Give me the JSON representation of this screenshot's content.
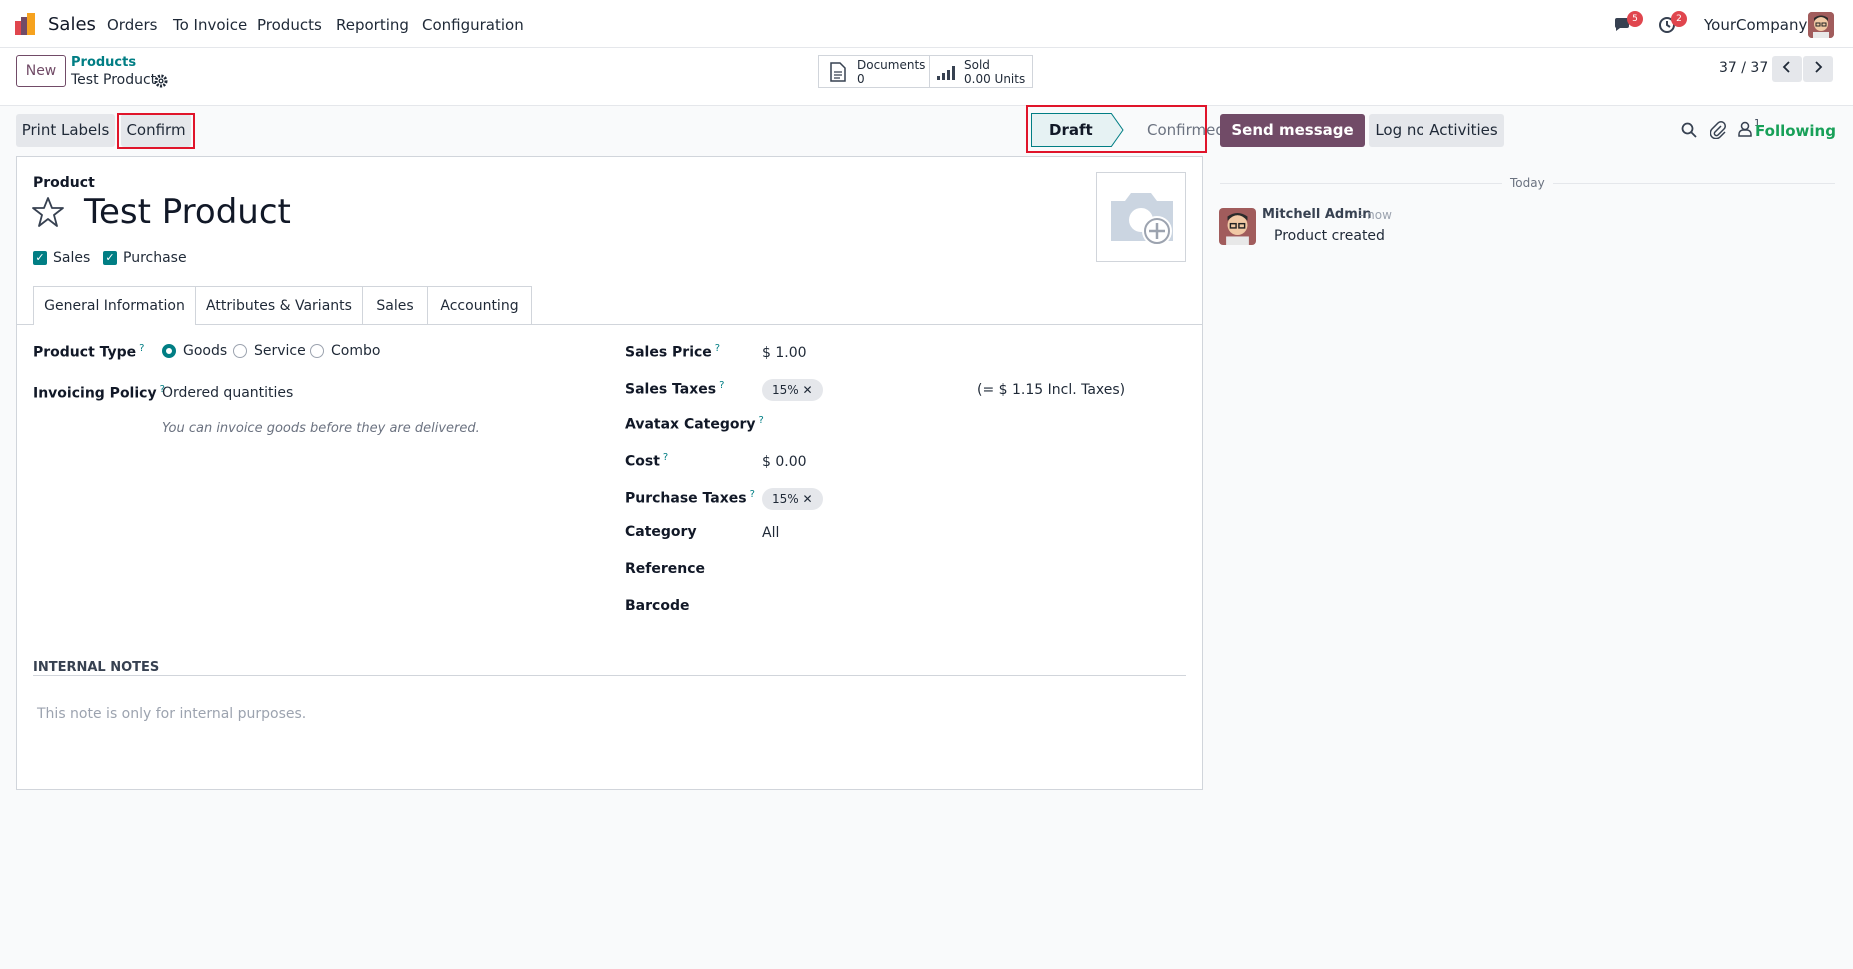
{
  "navbar": {
    "app_name": "Sales",
    "menu": [
      "Orders",
      "To Invoice",
      "Products",
      "Reporting",
      "Configuration"
    ],
    "messages_badge": "5",
    "activities_badge": "2",
    "company": "YourCompany"
  },
  "control": {
    "new_label": "New",
    "breadcrumb_parent": "Products",
    "breadcrumb_current": "Test Product",
    "documents_label": "Documents",
    "documents_count": "0",
    "sold_label": "Sold",
    "sold_value": "0.00 Units",
    "pager": "37 / 37"
  },
  "actions": {
    "print_labels": "Print Labels",
    "confirm": "Confirm",
    "status_draft": "Draft",
    "status_confirmed": "Confirmed"
  },
  "form": {
    "product_label": "Product",
    "product_name": "Test Product",
    "sales_checkbox": "Sales",
    "purchase_checkbox": "Purchase",
    "tabs": [
      "General Information",
      "Attributes & Variants",
      "Sales",
      "Accounting"
    ],
    "product_type_label": "Product Type",
    "product_type_options": [
      "Goods",
      "Service",
      "Combo"
    ],
    "invoicing_policy_label": "Invoicing Policy",
    "invoicing_policy_value": "Ordered quantities",
    "invoicing_hint": "You can invoice goods before they are delivered.",
    "sales_price_label": "Sales Price",
    "sales_price_value": "$ 1.00",
    "sales_taxes_label": "Sales Taxes",
    "sales_taxes_tag": "15%",
    "incl_taxes": "(= $ 1.15 Incl. Taxes)",
    "avatax_label": "Avatax Category",
    "cost_label": "Cost",
    "cost_value": "$ 0.00",
    "purchase_taxes_label": "Purchase Taxes",
    "purchase_taxes_tag": "15%",
    "category_label": "Category",
    "category_value": "All",
    "reference_label": "Reference",
    "barcode_label": "Barcode",
    "internal_notes_title": "INTERNAL NOTES",
    "internal_notes_placeholder": "This note is only for internal purposes."
  },
  "chatter": {
    "send_message": "Send message",
    "log_note": "Log note",
    "activities": "Activities",
    "followers_count": "1",
    "following": "Following",
    "date_separator": "Today",
    "message_author": "Mitchell Admin",
    "message_time": "- now",
    "message_body": "Product created"
  },
  "colors": {
    "brand": "#714b67",
    "accent": "#017e84",
    "highlight": "#e0142a"
  }
}
